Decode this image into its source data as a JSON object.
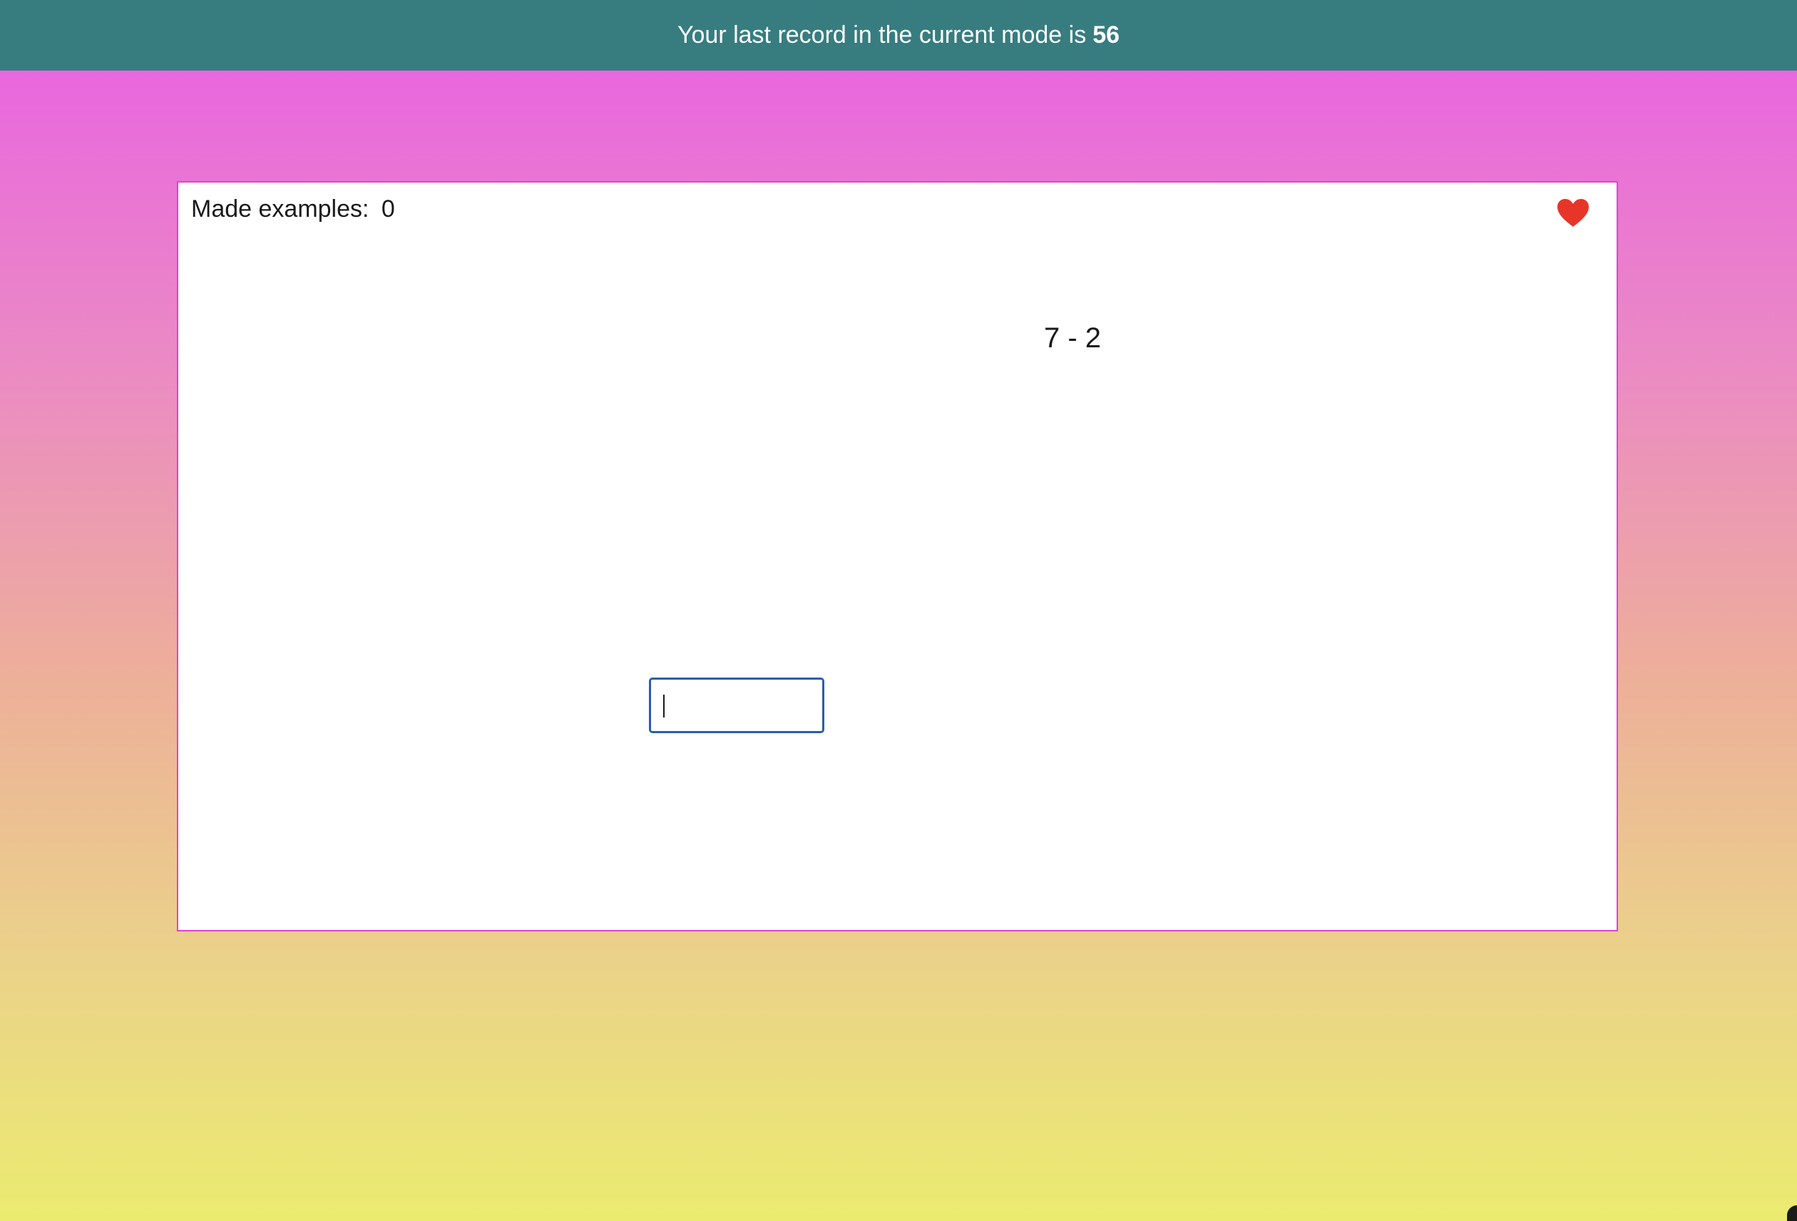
{
  "header": {
    "record_prefix": "Your last record in the current mode is",
    "record_value": "56",
    "background_color": "#377d80"
  },
  "game": {
    "counter_label": "Made examples:",
    "counter_value": "0",
    "lives_icon": "heart-icon",
    "lives_color": "#e8352a",
    "example_text": "7 - 2",
    "answer_value": "",
    "answer_placeholder": ""
  }
}
